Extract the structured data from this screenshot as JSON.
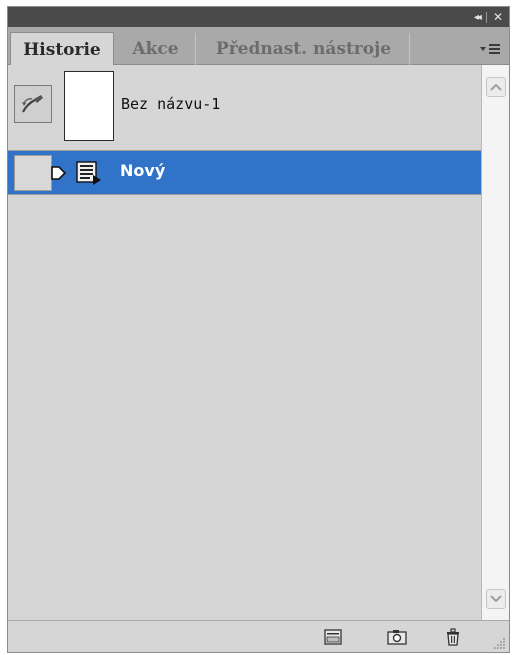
{
  "tabs": [
    {
      "label": "Historie",
      "active": true
    },
    {
      "label": "Akce",
      "active": false
    },
    {
      "label": "Přednast. nástroje",
      "active": false
    }
  ],
  "titlebar": {
    "collapse_glyph": "◂◂",
    "close_glyph": "✕"
  },
  "panel_menu": {
    "glyph": "▾≡"
  },
  "snapshot": {
    "label": "Bez názvu-1",
    "icon": "history-brush-icon"
  },
  "states": [
    {
      "label": "Nový",
      "icon": "new-document-state-icon",
      "selected": true
    }
  ],
  "bottom_buttons": [
    {
      "icon": "new-document-from-state-icon"
    },
    {
      "icon": "create-snapshot-icon"
    },
    {
      "icon": "delete-state-icon"
    }
  ],
  "colors": {
    "selected_row": "#3173c9",
    "panel_bg": "#d6d6d6",
    "titlebar_bg": "#4a4a4a"
  }
}
